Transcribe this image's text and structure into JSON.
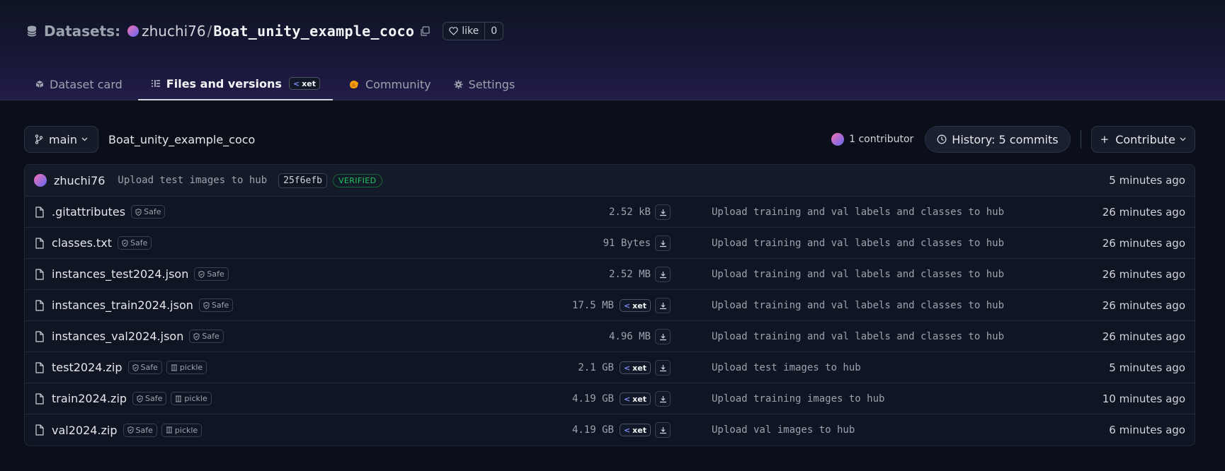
{
  "header": {
    "section_label": "Datasets:",
    "owner": "zhuchi76",
    "slash": "/",
    "repo_name": "Boat_unity_example_coco",
    "like_label": "like",
    "like_count": "0"
  },
  "tabs": [
    {
      "label": "Dataset card",
      "icon": "cube-icon",
      "active": false
    },
    {
      "label": "Files and versions",
      "icon": "files-icon",
      "active": true,
      "badge": "xet"
    },
    {
      "label": "Community",
      "icon": "community-icon",
      "active": false
    },
    {
      "label": "Settings",
      "icon": "gear-icon",
      "active": false
    }
  ],
  "toolbar": {
    "branch": "main",
    "path": "Boat_unity_example_coco",
    "contributors": "1 contributor",
    "history": "History: 5 commits",
    "contribute": "Contribute"
  },
  "last_commit": {
    "author": "zhuchi76",
    "message": "Upload test images to hub",
    "sha": "25f6efb",
    "verified": "VERIFIED",
    "time": "5 minutes ago"
  },
  "files": [
    {
      "name": ".gitattributes",
      "safe": "Safe",
      "pickle": null,
      "size": "2.52 kB",
      "xet": null,
      "message": "Upload training and val labels and classes to hub",
      "time": "26 minutes ago"
    },
    {
      "name": "classes.txt",
      "safe": "Safe",
      "pickle": null,
      "size": "91 Bytes",
      "xet": null,
      "message": "Upload training and val labels and classes to hub",
      "time": "26 minutes ago"
    },
    {
      "name": "instances_test2024.json",
      "safe": "Safe",
      "pickle": null,
      "size": "2.52 MB",
      "xet": null,
      "message": "Upload training and val labels and classes to hub",
      "time": "26 minutes ago"
    },
    {
      "name": "instances_train2024.json",
      "safe": "Safe",
      "pickle": null,
      "size": "17.5 MB",
      "xet": "xet",
      "message": "Upload training and val labels and classes to hub",
      "time": "26 minutes ago"
    },
    {
      "name": "instances_val2024.json",
      "safe": "Safe",
      "pickle": null,
      "size": "4.96 MB",
      "xet": null,
      "message": "Upload training and val labels and classes to hub",
      "time": "26 minutes ago"
    },
    {
      "name": "test2024.zip",
      "safe": "Safe",
      "pickle": "pickle",
      "size": "2.1 GB",
      "xet": "xet",
      "message": "Upload test images to hub",
      "time": "5 minutes ago"
    },
    {
      "name": "train2024.zip",
      "safe": "Safe",
      "pickle": "pickle",
      "size": "4.19 GB",
      "xet": "xet",
      "message": "Upload training images to hub",
      "time": "10 minutes ago"
    },
    {
      "name": "val2024.zip",
      "safe": "Safe",
      "pickle": "pickle",
      "size": "4.19 GB",
      "xet": "xet",
      "message": "Upload val images to hub",
      "time": "6 minutes ago"
    }
  ],
  "colors": {
    "background": "#0b0f19",
    "header_gradient_end": "#231c4a",
    "verified_green": "#22c55e",
    "xet_accent": "#818cf8"
  }
}
